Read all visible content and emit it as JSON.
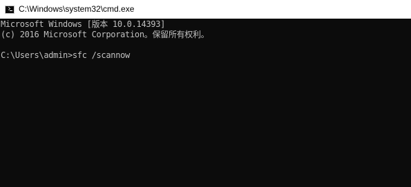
{
  "window": {
    "title": "C:\\Windows\\system32\\cmd.exe",
    "icon": "cmd-console-icon"
  },
  "console": {
    "lines": [
      "Microsoft Windows [版本 10.0.14393]",
      "(c) 2016 Microsoft Corporation。保留所有权利。",
      "",
      "C:\\Users\\admin>sfc /scannow"
    ]
  },
  "colors": {
    "background": "#0c0c0c",
    "text": "#c0c0c0",
    "titlebar": "#ffffff"
  }
}
